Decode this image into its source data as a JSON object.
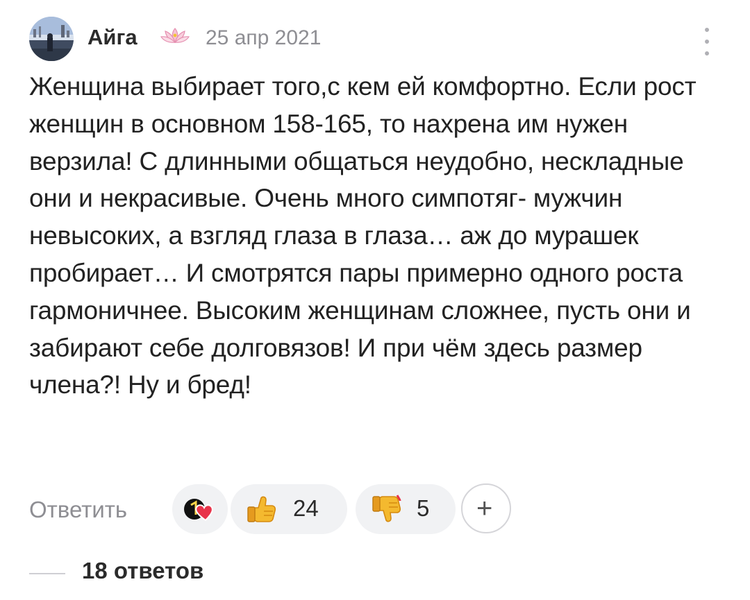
{
  "comment": {
    "author": "Айга",
    "date": "25 апр 2021",
    "text": "Женщина выбирает того,с кем ей комфортно. Если рост женщин в основном 158-165, то нахрена им нужен верзила! С длинными общаться неудобно, нескладные они и некрасивые. Очень много симпотяг- мужчин невысоких, а взгляд глаза в глаза… аж до мурашек пробирает… И смотрятся пары примерно одного роста гармоничнее. Высоким женщинам сложнее, пусть они и забирают себе долговязов! И при чём здесь размер члена?! Ну и бред!"
  },
  "actions": {
    "reply_label": "Ответить",
    "reactions": [
      {
        "icon": "thumbs-up-icon",
        "count": "24"
      },
      {
        "icon": "thumbs-down-icon",
        "count": "5"
      }
    ],
    "add_label": "+"
  },
  "replies": {
    "label": "18 ответов"
  },
  "colors": {
    "muted": "#8e8e93",
    "pill_bg": "#f1f2f4",
    "text": "#222222"
  }
}
